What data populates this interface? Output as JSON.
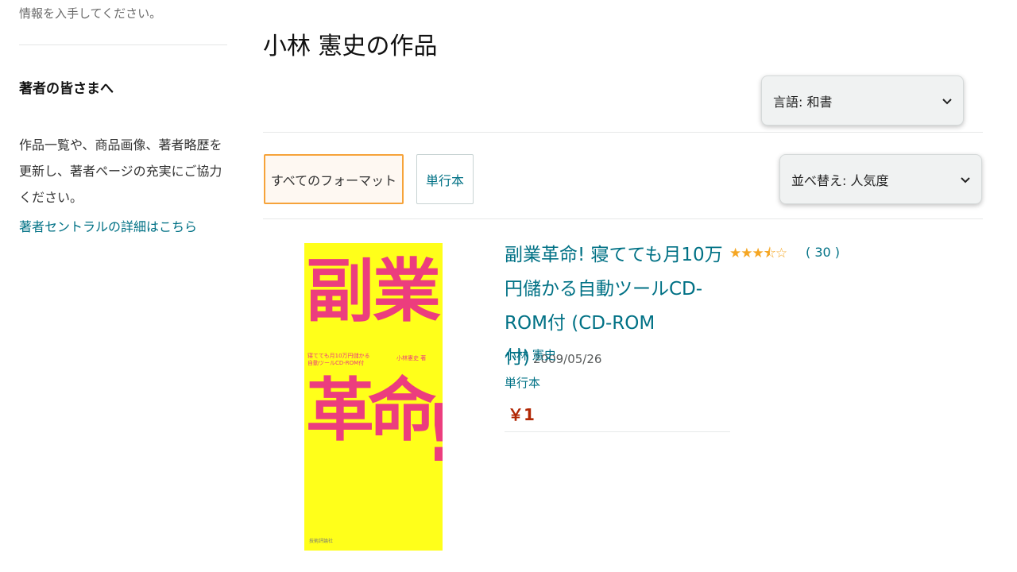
{
  "sidebar": {
    "top_text": "情報を入手してください。",
    "heading": "著者の皆さまへ",
    "body_lines": [
      "作品一覧や、商品画像、著者略歴を",
      "更新し、著者ページの充実にご協力",
      "ください。"
    ],
    "link": "著者セントラルの詳細はこちら"
  },
  "main": {
    "title": "小林 憲史の作品",
    "language_select": {
      "value": "言語:  和書"
    },
    "format_buttons": [
      {
        "label": "すべてのフォーマット",
        "selected": true
      },
      {
        "label": "単行本",
        "selected": false
      }
    ],
    "sort_select": {
      "value": "並べ替え:  人気度"
    }
  },
  "product": {
    "title": "副業革命! 寝てても月10万円儲かる自動ツールCD-ROM付 (CD-ROM付)",
    "date": "2009/05/26",
    "rating": 3.5,
    "stars_display": "★★★⯪☆",
    "rating_count": "( 30 )",
    "author": "小林 憲史",
    "format": "単行本",
    "price": "￥1",
    "cover": {
      "big_chars": [
        "副",
        "業",
        "革",
        "命",
        "!"
      ],
      "author_text": "小林憲史 著",
      "colors": {
        "background": "#ffff1a",
        "text": "#ec3d7e"
      }
    }
  },
  "colors": {
    "link": "#007185",
    "price": "#b12704",
    "accent_border": "#f6a33a",
    "star": "#f5a623"
  },
  "icons": {
    "select_chevron": "chevron-down-icon"
  }
}
